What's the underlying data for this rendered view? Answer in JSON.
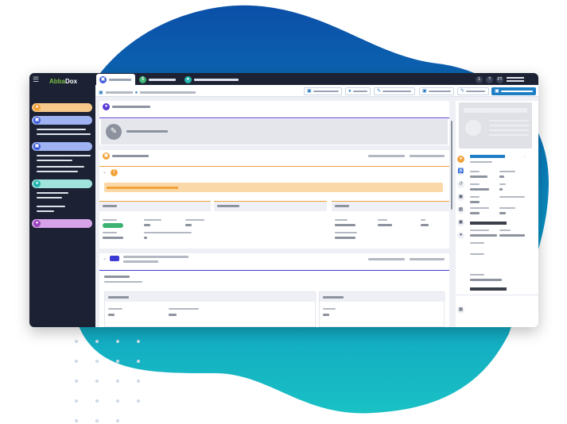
{
  "app": {
    "logo_text_a": "Abba",
    "logo_text_b": "Dox"
  },
  "topbar": {
    "avatar_initials": "FT",
    "help_icon": "?",
    "chat_badge": "1"
  },
  "icons": {
    "menu": "hamburger-icon",
    "alert": "!"
  },
  "colors": {
    "sidebar": "#1c2233",
    "accent_blue": "#1f7fc5",
    "accent_purple": "#5b3bd6",
    "accent_orange": "#f2a23a",
    "status_green": "#3cb371",
    "teal": "#23b5b0"
  }
}
